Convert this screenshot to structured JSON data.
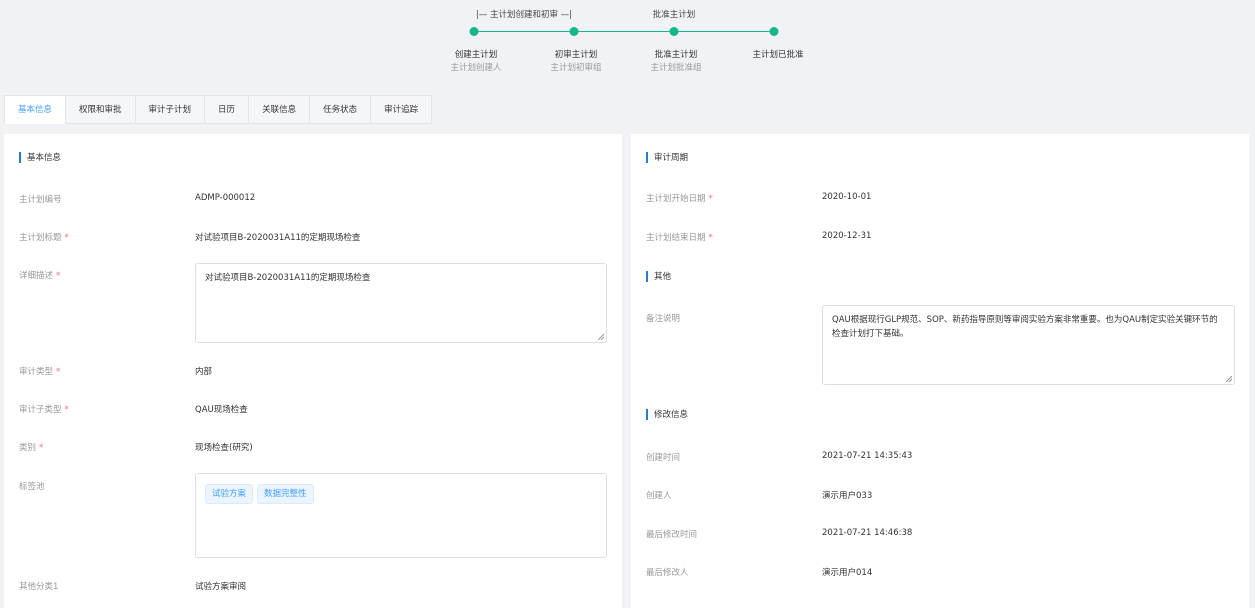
{
  "workflow": {
    "group1_label": "|— 主计划创建和初审 —|",
    "group2_label": "批准主计划",
    "steps": [
      {
        "title": "创建主计划",
        "subtitle": "主计划创建人"
      },
      {
        "title": "初审主计划",
        "subtitle": "主计划初审组"
      },
      {
        "title": "批准主计划",
        "subtitle": "主计划批准组"
      },
      {
        "title": "主计划已批准",
        "subtitle": ""
      }
    ],
    "accent_color": "#12b886"
  },
  "tabs": [
    {
      "label": "基本信息",
      "active": true
    },
    {
      "label": "权限和审批",
      "active": false
    },
    {
      "label": "审计子计划",
      "active": false
    },
    {
      "label": "日历",
      "active": false
    },
    {
      "label": "关联信息",
      "active": false
    },
    {
      "label": "任务状态",
      "active": false
    },
    {
      "label": "审计追踪",
      "active": false
    }
  ],
  "basic_info": {
    "section_title": "基本信息",
    "plan_no_label": "主计划编号",
    "plan_no": "ADMP-000012",
    "plan_title_label": "主计划标题",
    "plan_title": "对试验项目B-2020031A11的定期现场检查",
    "description_label": "详细描述",
    "description": "对试验项目B-2020031A11的定期现场检查",
    "audit_type_label": "审计类型",
    "audit_type": "内部",
    "audit_subtype_label": "审计子类型",
    "audit_subtype": "QAU现场检查",
    "category_label": "类别",
    "category": "现场检查(研究)",
    "tag_pool_label": "标签池",
    "tags": [
      "试验方案",
      "数据完整性"
    ],
    "other_category_label": "其他分类1",
    "other_category": "试验方案审阅",
    "required_mark": "*"
  },
  "audit_period": {
    "section_title": "审计周期",
    "start_label": "主计划开始日期",
    "start_date": "2020-10-01",
    "end_label": "主计划结束日期",
    "end_date": "2020-12-31"
  },
  "other": {
    "section_title": "其他",
    "remark_label": "备注说明",
    "remark": "QAU根据现行GLP规范、SOP、新药指导原则等审阅实验方案非常重要。也为QAU制定实验关键环节的检查计划打下基础。"
  },
  "modify_info": {
    "section_title": "修改信息",
    "created_time_label": "创建时间",
    "created_time": "2021-07-21 14:35:43",
    "creator_label": "创建人",
    "creator": "演示用户033",
    "modified_time_label": "最后修改时间",
    "modified_time": "2021-07-21 14:46:38",
    "modifier_label": "最后修改人",
    "modifier": "演示用户014"
  },
  "colors": {
    "accent_blue": "#409eff",
    "section_bar": "#1f7fd4",
    "required": "#f56c6c"
  }
}
